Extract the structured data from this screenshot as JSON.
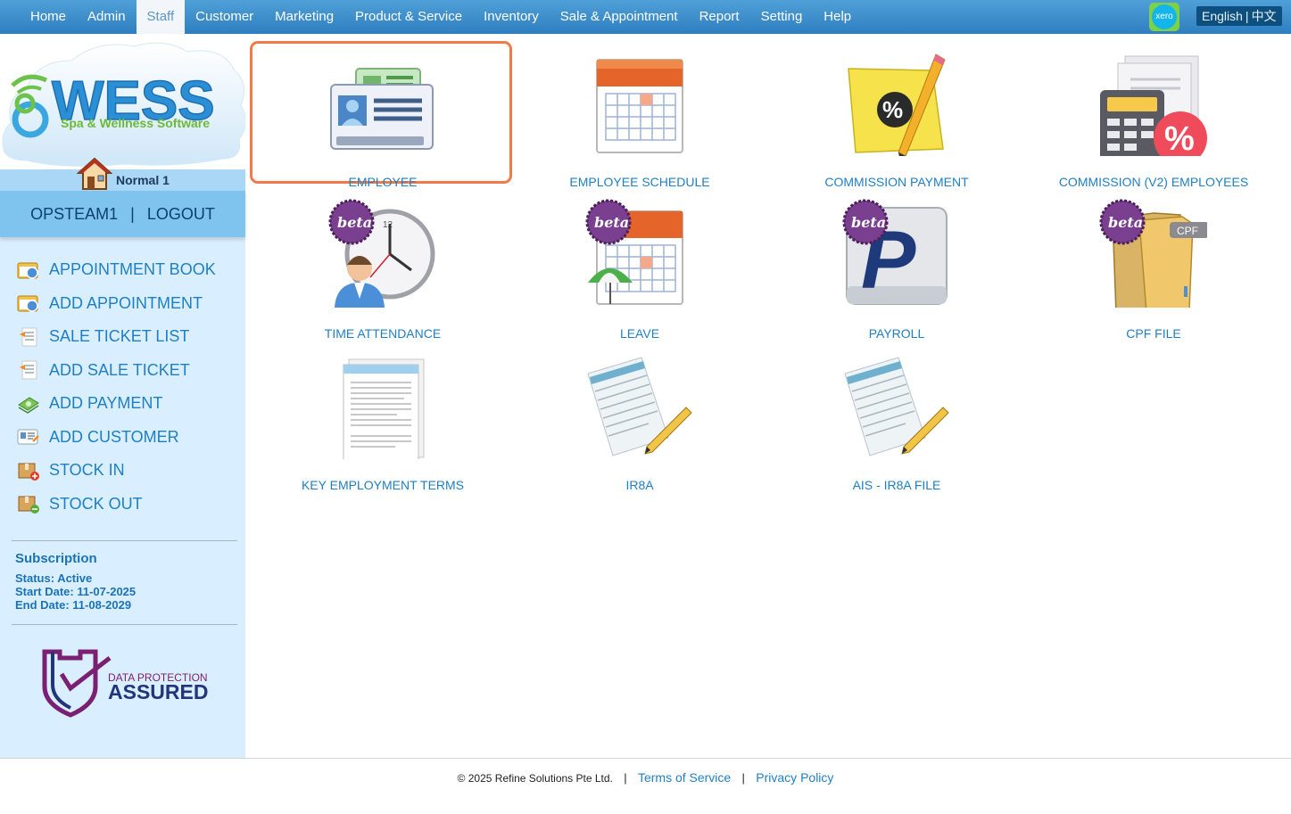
{
  "nav": {
    "items": [
      "Home",
      "Admin",
      "Staff",
      "Customer",
      "Marketing",
      "Product & Service",
      "Inventory",
      "Sale & Appointment",
      "Report",
      "Setting",
      "Help"
    ],
    "active": "Staff"
  },
  "xero": {
    "label": "xero"
  },
  "lang": {
    "english": "English",
    "sep": "|",
    "chinese": "中文"
  },
  "logo": {
    "brand": "WESS",
    "tagline": "Spa & Wellness Software"
  },
  "user": {
    "name": "Normal 1"
  },
  "login": {
    "account": "OPSTEAM1",
    "sep": "|",
    "logout": "LOGOUT"
  },
  "sidebar": {
    "items": [
      {
        "label": "APPOINTMENT BOOK",
        "icon": "appointment-book-icon"
      },
      {
        "label": "ADD APPOINTMENT",
        "icon": "add-appointment-icon"
      },
      {
        "label": "SALE TICKET LIST",
        "icon": "sale-ticket-list-icon"
      },
      {
        "label": "ADD SALE TICKET",
        "icon": "add-sale-ticket-icon"
      },
      {
        "label": "ADD PAYMENT",
        "icon": "add-payment-icon"
      },
      {
        "label": "ADD CUSTOMER",
        "icon": "add-customer-icon"
      },
      {
        "label": "STOCK IN",
        "icon": "stock-in-icon"
      },
      {
        "label": "STOCK OUT",
        "icon": "stock-out-icon"
      }
    ]
  },
  "subscription": {
    "title": "Subscription",
    "status": "Status: Active",
    "start": "Start Date: 11-07-2025",
    "end": "End Date: 11-08-2029"
  },
  "dpa": {
    "line1": "DATA PROTECTION",
    "line2": "ASSURED"
  },
  "tiles": [
    {
      "label": "EMPLOYEE",
      "icon": "employee-card-icon",
      "beta": false,
      "selected": true
    },
    {
      "label": "EMPLOYEE SCHEDULE",
      "icon": "calendar-icon",
      "beta": false
    },
    {
      "label": "COMMISSION PAYMENT",
      "icon": "commission-note-icon",
      "beta": false
    },
    {
      "label": "COMMISSION (V2) EMPLOYEES",
      "icon": "calculator-percent-icon",
      "beta": false
    },
    {
      "label": "TIME ATTENDANCE",
      "icon": "clock-person-icon",
      "beta": true
    },
    {
      "label": "LEAVE",
      "icon": "calendar-umbrella-icon",
      "beta": true
    },
    {
      "label": "PAYROLL",
      "icon": "payroll-p-icon",
      "beta": true
    },
    {
      "label": "CPF FILE",
      "icon": "cpf-folder-icon",
      "beta": true,
      "tag": "CPF"
    },
    {
      "label": "KEY EMPLOYMENT TERMS",
      "icon": "document-stack-icon",
      "beta": false
    },
    {
      "label": "IR8A",
      "icon": "document-pencil-icon",
      "beta": false
    },
    {
      "label": "AIS - IR8A FILE",
      "icon": "document-pencil-icon",
      "beta": false
    }
  ],
  "beta_label": "beta",
  "footer": {
    "copyright": "© 2025 Refine Solutions Pte Ltd.",
    "sep": "|",
    "terms": "Terms of Service",
    "privacy": "Privacy Policy"
  },
  "colors": {
    "nav": "#3a8ccc",
    "link": "#1f7fc4",
    "sidebar": "#d9efff",
    "selected_border": "#f07a4a"
  }
}
